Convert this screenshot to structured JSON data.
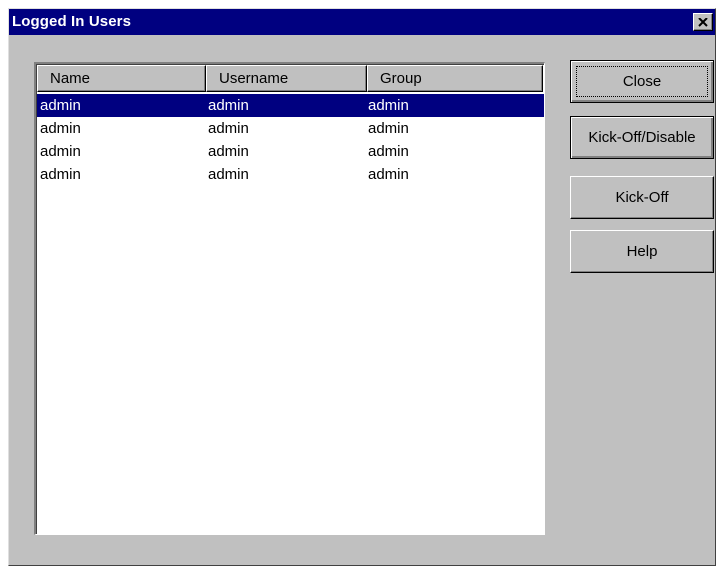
{
  "window": {
    "title": "Logged In Users",
    "close_glyph": "×",
    "close_icon": "close-icon"
  },
  "listview": {
    "columns": [
      "Name",
      "Username",
      "Group"
    ],
    "rows": [
      {
        "name": "admin",
        "username": "admin",
        "group": "admin",
        "selected": true
      },
      {
        "name": "admin",
        "username": "admin",
        "group": "admin",
        "selected": false
      },
      {
        "name": "admin",
        "username": "admin",
        "group": "admin",
        "selected": false
      },
      {
        "name": "admin",
        "username": "admin",
        "group": "admin",
        "selected": false
      }
    ]
  },
  "buttons": {
    "close": "Close",
    "kick_off_disable": "Kick-Off/Disable",
    "kick_off": "Kick-Off",
    "help": "Help"
  },
  "colors": {
    "titlebar": "#000080",
    "selection": "#000080",
    "face": "#c0c0c0"
  }
}
